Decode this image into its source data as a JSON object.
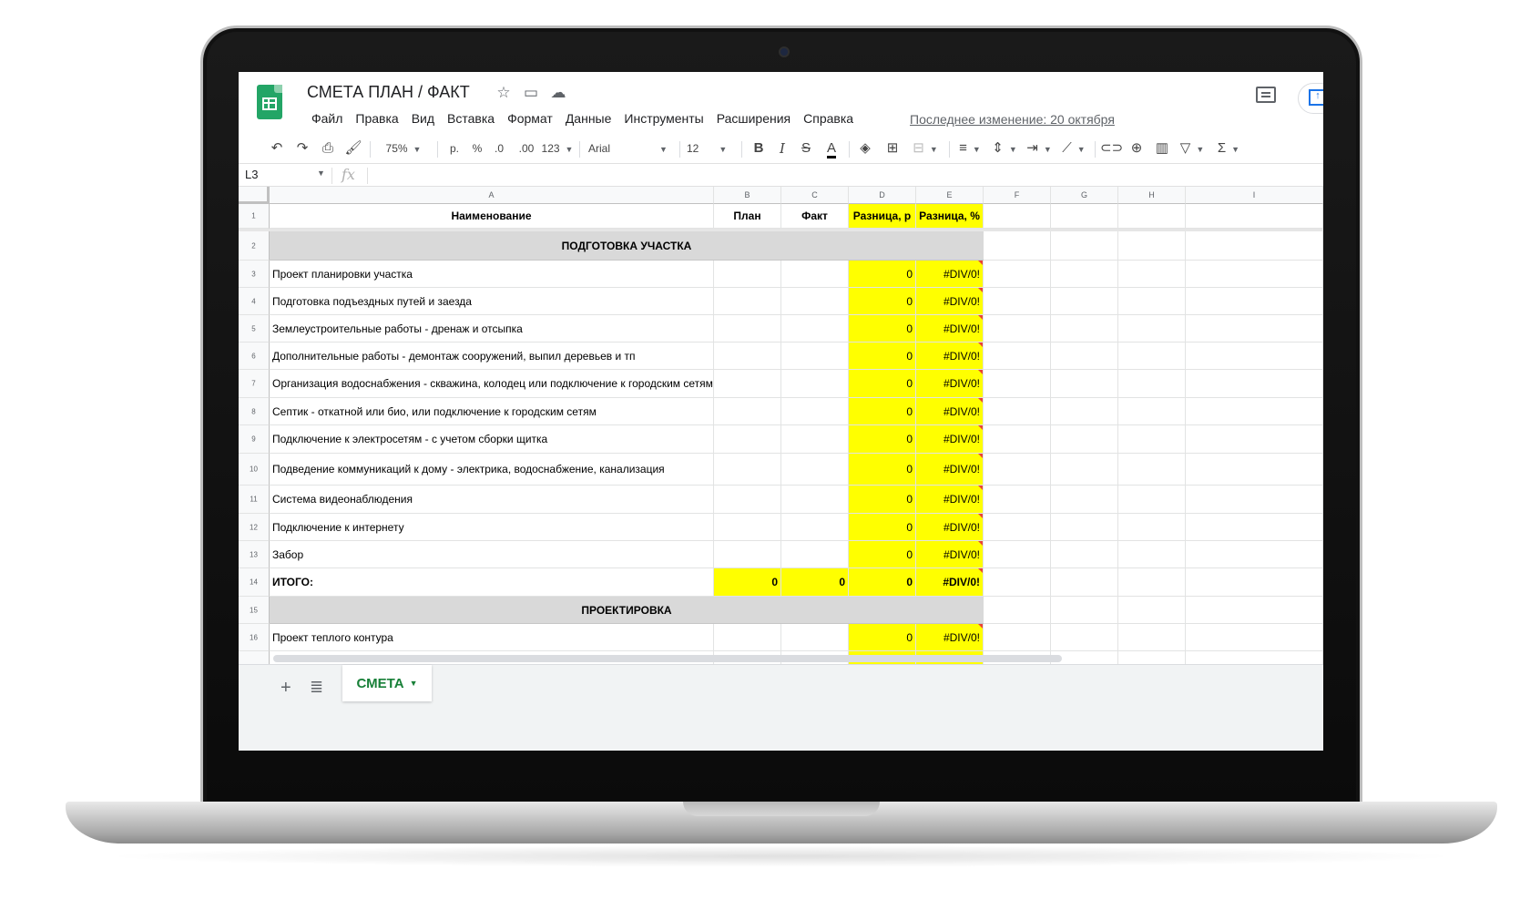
{
  "app": {
    "doc_title": "СМЕТА ПЛАН / ФАКТ",
    "last_edit": "Последнее изменение: 20 октября",
    "menu": [
      "Файл",
      "Правка",
      "Вид",
      "Вставка",
      "Формат",
      "Данные",
      "Инструменты",
      "Расширения",
      "Справка"
    ]
  },
  "toolbar": {
    "zoom": "75%",
    "currency": "р.",
    "percent": "%",
    "dec_less": ".0",
    "dec_more": ".00",
    "more_formats": "123",
    "font": "Arial",
    "font_size": "12",
    "bold": "B",
    "italic": "I",
    "strike": "S",
    "text_color": "A"
  },
  "formula_bar": {
    "cell_ref": "L3",
    "fx": "fx",
    "value": ""
  },
  "grid": {
    "columns": [
      "A",
      "B",
      "C",
      "D",
      "E",
      "F",
      "G",
      "H",
      "I"
    ],
    "header_row": {
      "num": "1",
      "a": "Наименование",
      "b": "План",
      "c": "Факт",
      "d": "Разница, р",
      "e": "Разница, %"
    },
    "rows": [
      {
        "num": "2",
        "section": "ПОДГОТОВКА УЧАСТКА"
      },
      {
        "num": "3",
        "a": "Проект планировки участка",
        "d": "0",
        "e": "#DIV/0!"
      },
      {
        "num": "4",
        "a": "Подготовка подъездных путей и заезда",
        "d": "0",
        "e": "#DIV/0!"
      },
      {
        "num": "5",
        "a": "Землеустроительные работы - дренаж и отсыпка",
        "d": "0",
        "e": "#DIV/0!"
      },
      {
        "num": "6",
        "a": "Дополнительные работы - демонтаж сооружений, выпил деревьев и тп",
        "d": "0",
        "e": "#DIV/0!"
      },
      {
        "num": "7",
        "a": "Организация водоснабжения - скважина, колодец или подключение к городским сетям",
        "d": "0",
        "e": "#DIV/0!"
      },
      {
        "num": "8",
        "a": "Септик - откатной или био, или подключение к городским сетям",
        "d": "0",
        "e": "#DIV/0!"
      },
      {
        "num": "9",
        "a": "Подключение к электросетям - с учетом сборки щитка",
        "d": "0",
        "e": "#DIV/0!"
      },
      {
        "num": "10",
        "a": "Подведение коммуникаций к дому - электрика, водоснабжение, канализация",
        "d": "0",
        "e": "#DIV/0!"
      },
      {
        "num": "11",
        "a": "Система видеонаблюдения",
        "d": "0",
        "e": "#DIV/0!"
      },
      {
        "num": "12",
        "a": "Подключение к интернету",
        "d": "0",
        "e": "#DIV/0!"
      },
      {
        "num": "13",
        "a": "Забор",
        "d": "0",
        "e": "#DIV/0!"
      },
      {
        "num": "14",
        "a": "ИТОГО:",
        "b": "0",
        "c": "0",
        "d": "0",
        "e": "#DIV/0!",
        "total": true
      },
      {
        "num": "15",
        "section": "ПРОЕКТИРОВКА"
      },
      {
        "num": "16",
        "a": "Проект теплого контура",
        "d": "0",
        "e": "#DIV/0!"
      }
    ]
  },
  "sheets": {
    "active": "СМЕТА"
  },
  "colors": {
    "highlight": "#ffff00",
    "section_bg": "#d9d9d9",
    "sheet_tab": "#188038"
  }
}
